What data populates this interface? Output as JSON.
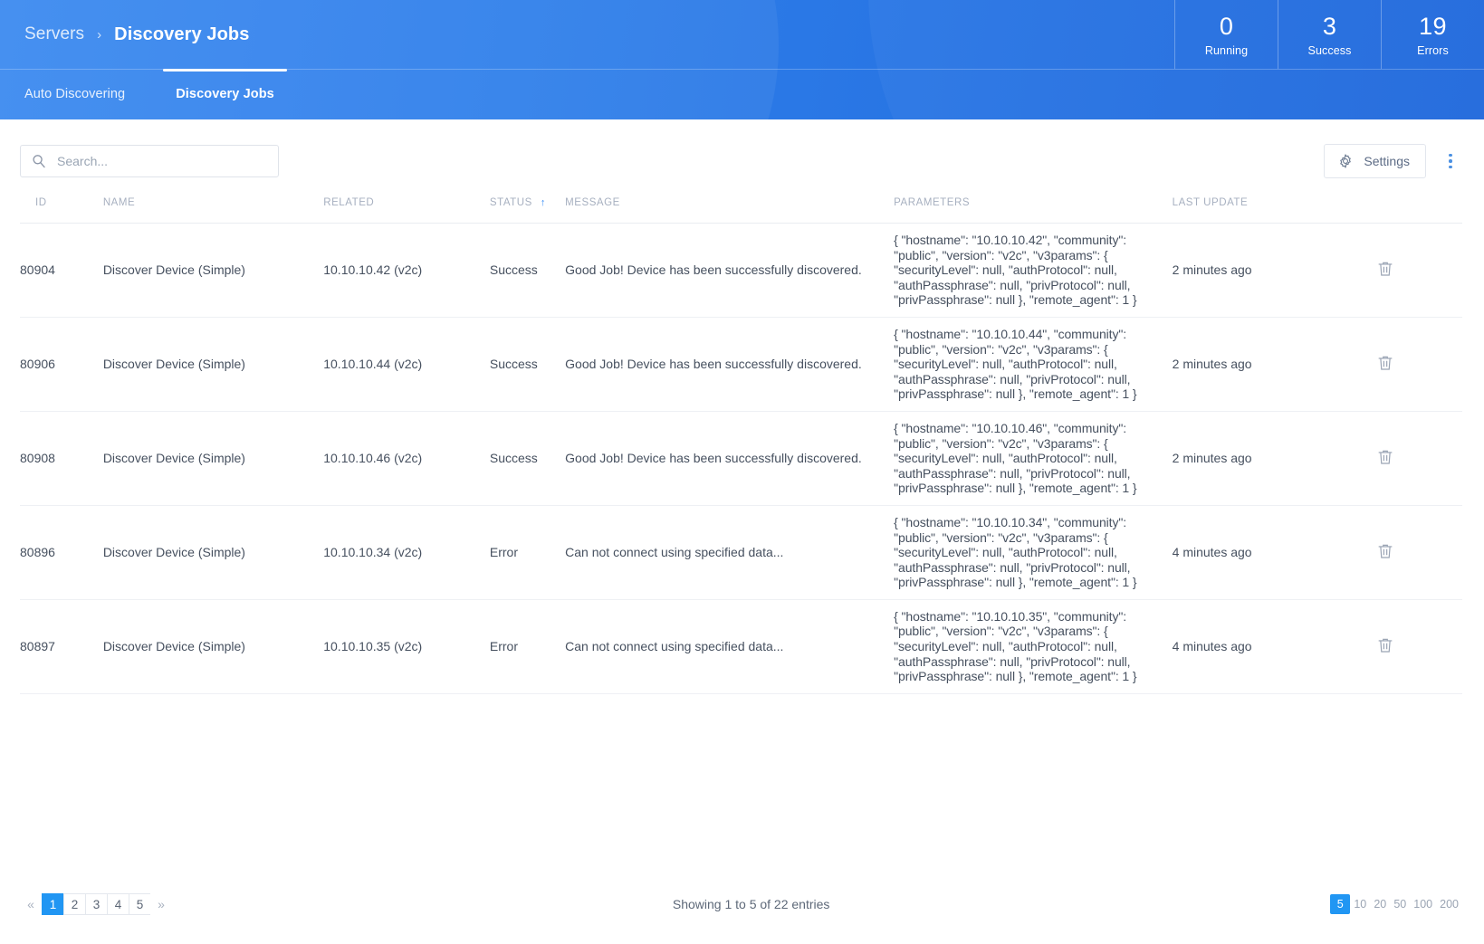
{
  "header": {
    "breadcrumb": {
      "root": "Servers",
      "separator": "›",
      "current": "Discovery Jobs"
    },
    "stats": [
      {
        "value": "0",
        "label": "Running"
      },
      {
        "value": "3",
        "label": "Success"
      },
      {
        "value": "19",
        "label": "Errors"
      }
    ],
    "tabs": [
      {
        "label": "Auto Discovering",
        "active": false
      },
      {
        "label": "Discovery Jobs",
        "active": true
      }
    ],
    "accent_color": "#2979e8"
  },
  "toolbar": {
    "search_placeholder": "Search...",
    "search_value": "",
    "search_icon": "search-icon",
    "settings_label": "Settings",
    "settings_icon": "gear-icon",
    "overflow_icon": "kebab-menu-icon"
  },
  "table": {
    "columns": [
      {
        "key": "id",
        "label": "ID"
      },
      {
        "key": "name",
        "label": "NAME"
      },
      {
        "key": "related",
        "label": "RELATED"
      },
      {
        "key": "status",
        "label": "STATUS"
      },
      {
        "key": "message",
        "label": "MESSAGE"
      },
      {
        "key": "parameters",
        "label": "PARAMETERS"
      },
      {
        "key": "last_update",
        "label": "LAST UPDATE"
      },
      {
        "key": "actions",
        "label": ""
      }
    ],
    "sort": {
      "column": "STATUS",
      "direction": "asc",
      "arrow": "↑"
    },
    "status_colors": {
      "Success": "#4bc38a",
      "Error": "#f2697b"
    },
    "row_action_icon": "trash-icon",
    "rows": [
      {
        "id": "80904",
        "name": "Discover Device (Simple)",
        "related": "10.10.10.42 (v2c)",
        "status": "Success",
        "message": "Good Job! Device has been successfully discovered.",
        "parameters": "{ \"hostname\": \"10.10.10.42\", \"community\": \"public\", \"version\": \"v2c\", \"v3params\": { \"securityLevel\": null, \"authProtocol\": null, \"authPassphrase\": null, \"privProtocol\": null, \"privPassphrase\": null }, \"remote_agent\": 1 }",
        "last_update": "2 minutes ago"
      },
      {
        "id": "80906",
        "name": "Discover Device (Simple)",
        "related": "10.10.10.44 (v2c)",
        "status": "Success",
        "message": "Good Job! Device has been successfully discovered.",
        "parameters": "{ \"hostname\": \"10.10.10.44\", \"community\": \"public\", \"version\": \"v2c\", \"v3params\": { \"securityLevel\": null, \"authProtocol\": null, \"authPassphrase\": null, \"privProtocol\": null, \"privPassphrase\": null }, \"remote_agent\": 1 }",
        "last_update": "2 minutes ago"
      },
      {
        "id": "80908",
        "name": "Discover Device (Simple)",
        "related": "10.10.10.46 (v2c)",
        "status": "Success",
        "message": "Good Job! Device has been successfully discovered.",
        "parameters": "{ \"hostname\": \"10.10.10.46\", \"community\": \"public\", \"version\": \"v2c\", \"v3params\": { \"securityLevel\": null, \"authProtocol\": null, \"authPassphrase\": null, \"privProtocol\": null, \"privPassphrase\": null }, \"remote_agent\": 1 }",
        "last_update": "2 minutes ago"
      },
      {
        "id": "80896",
        "name": "Discover Device (Simple)",
        "related": "10.10.10.34 (v2c)",
        "status": "Error",
        "message": "Can not connect using specified data...",
        "parameters": "{ \"hostname\": \"10.10.10.34\", \"community\": \"public\", \"version\": \"v2c\", \"v3params\": { \"securityLevel\": null, \"authProtocol\": null, \"authPassphrase\": null, \"privProtocol\": null, \"privPassphrase\": null }, \"remote_agent\": 1 }",
        "last_update": "4 minutes ago"
      },
      {
        "id": "80897",
        "name": "Discover Device (Simple)",
        "related": "10.10.10.35 (v2c)",
        "status": "Error",
        "message": "Can not connect using specified data...",
        "parameters": "{ \"hostname\": \"10.10.10.35\", \"community\": \"public\", \"version\": \"v2c\", \"v3params\": { \"securityLevel\": null, \"authProtocol\": null, \"authPassphrase\": null, \"privProtocol\": null, \"privPassphrase\": null }, \"remote_agent\": 1 }",
        "last_update": "4 minutes ago"
      }
    ]
  },
  "footer": {
    "prev_label": "«",
    "next_label": "»",
    "pages": [
      "1",
      "2",
      "3",
      "4",
      "5"
    ],
    "active_page": "1",
    "showing_text": "Showing 1 to 5 of 22 entries",
    "page_sizes": [
      "5",
      "10",
      "20",
      "50",
      "100",
      "200"
    ],
    "active_page_size": "5"
  }
}
